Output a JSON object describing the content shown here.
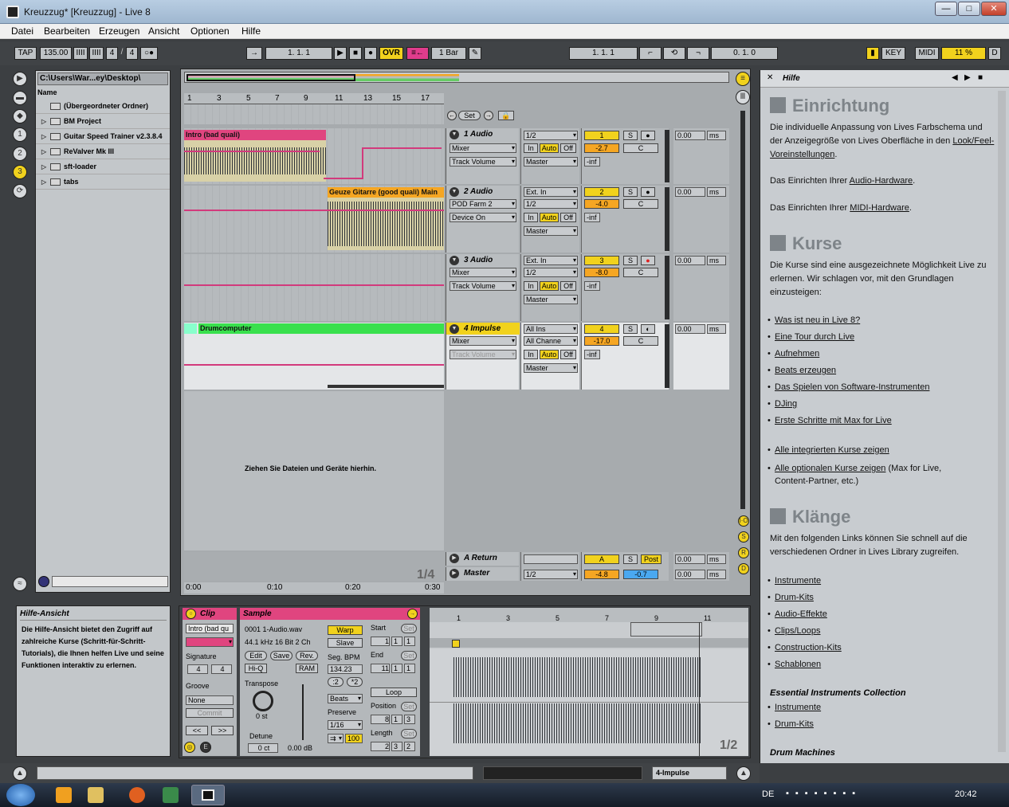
{
  "window": {
    "title": "Kreuzzug*  [Kreuzzug] - Live 8",
    "min": "—",
    "max": "□",
    "close": "✕"
  },
  "menu": [
    "Datei",
    "Bearbeiten",
    "Erzeugen",
    "Ansicht",
    "Optionen",
    "Hilfe"
  ],
  "toolbar": {
    "tap": "TAP",
    "tempo": "135.00",
    "sig_num": "4",
    "sig_den": "4",
    "sig_sep": "/",
    "pos": "1.   1.   1",
    "ovr": "OVR",
    "quant": "1 Bar",
    "loop_start": "1.   1.   1",
    "loop_len": "0.   1.   0",
    "key": "KEY",
    "midi": "MIDI",
    "cpu": "11 %",
    "d": "D"
  },
  "browser": {
    "path": "C:\\Users\\War...ey\\Desktop\\",
    "header": "Name",
    "items": [
      "(Übergeordneter Ordner)",
      "BM Project",
      "Guitar Speed Trainer v2.3.8.4",
      "ReValver Mk III",
      "sft-loader",
      "tabs"
    ]
  },
  "ruler": {
    "bars": [
      "1",
      "3",
      "5",
      "7",
      "9",
      "11",
      "13",
      "15",
      "17"
    ],
    "times": [
      "0:00",
      "0:10",
      "0:20",
      "0:30"
    ],
    "ratio": "1/4",
    "set": "Set"
  },
  "tracks": [
    {
      "name": "1 Audio",
      "clip": "Intro (bad quali)",
      "in": "1/2",
      "dev": "Mixer",
      "param": "Track Volume",
      "out": "Master",
      "num": "1",
      "vol": "-2.7",
      "pan": "C",
      "meter": "0.00",
      "ms": "ms",
      "inf": "-inf"
    },
    {
      "name": "2 Audio",
      "clip": "Geuze Gitarre (good quali) Main",
      "in": "Ext. In",
      "in2": "1/2",
      "dev": "POD Farm 2",
      "param": "Device On",
      "out": "Master",
      "num": "2",
      "vol": "-4.0",
      "pan": "C",
      "meter": "0.00",
      "ms": "ms",
      "inf": "-inf"
    },
    {
      "name": "3 Audio",
      "clip": "",
      "in": "Ext. In",
      "in2": "1/2",
      "dev": "Mixer",
      "param": "Track Volume",
      "out": "Master",
      "num": "3",
      "vol": "-8.0",
      "pan": "C",
      "meter": "0.00",
      "ms": "ms",
      "inf": "-inf"
    },
    {
      "name": "4 Impulse",
      "clip": "Drumcomputer",
      "in": "All Ins",
      "in2": "All Channe",
      "dev": "Mixer",
      "param": "Track Volume",
      "out": "Master",
      "num": "4",
      "vol": "-17.0",
      "pan": "C",
      "meter": "0.00",
      "ms": "ms",
      "inf": "-inf"
    }
  ],
  "monitor": {
    "in": "In",
    "auto": "Auto",
    "off": "Off",
    "solo": "S"
  },
  "drop_hint": "Ziehen Sie Dateien und Geräte hierhin.",
  "returns": {
    "a": "A Return",
    "a_letter": "A",
    "a_post": "Post",
    "master": "Master",
    "master_in": "1/2",
    "master_vol": "-4.8",
    "master_pan": "-0.7",
    "a_meter": "0.00",
    "m_meter": "0.00"
  },
  "help": {
    "title": "Hilfe",
    "h1": "Einrichtung",
    "p1a": "Die individuelle Anpassung von Lives Farbschema und der Anzeigegröße von Lives Oberfläche in den",
    "p1b": "Look/Feel-Voreinstellungen",
    "p2a": "Das Einrichten Ihrer",
    "p2b": "Audio-Hardware",
    "p3a": "Das Einrichten Ihrer",
    "p3b": "MIDI-Hardware",
    "h2": "Kurse",
    "p4": "Die Kurse sind eine ausgezeichnete Möglichkeit Live zu erlernen. Wir schlagen vor, mit den Grundlagen einzusteigen:",
    "links1": [
      "Was ist neu in Live 8?",
      "Eine Tour durch Live",
      "Aufnehmen",
      "Beats erzeugen",
      "Das Spielen von Software-Instrumenten",
      "DJing",
      "Erste Schritte mit Max for Live"
    ],
    "links2a": "Alle integrierten Kurse zeigen",
    "links2b": "Alle optionalen Kurse zeigen",
    "links2b_rest": "(Max for Live, Content-Partner, etc.)",
    "h3": "Klänge",
    "p5": "Mit den folgenden Links können Sie schnell auf die verschiedenen Ordner in Lives Library zugreifen.",
    "links3": [
      "Instrumente",
      "Drum-Kits",
      "Audio-Effekte",
      "Clips/Loops",
      "Construction-Kits",
      "Schablonen"
    ],
    "sub1": "Essential Instruments Collection",
    "links4": [
      "Instrumente",
      "Drum-Kits"
    ],
    "sub2": "Drum Machines"
  },
  "info": {
    "title": "Hilfe-Ansicht",
    "text": "Die Hilfe-Ansicht bietet den Zugriff auf zahlreiche Kurse (Schritt-für-Schritt-Tutorials), die Ihnen helfen Live und seine Funktionen interaktiv zu erlernen."
  },
  "clipview": {
    "clip": "Clip",
    "name": "Intro (bad qu",
    "signature": "Signature",
    "sig_n": "4",
    "sig_d": "4",
    "groove": "Groove",
    "groove_val": "None",
    "commit": "Commit",
    "sample": "Sample",
    "file": "0001 1-Audio.wav",
    "format": "44.1 kHz 16 Bit 2 Ch",
    "edit": "Edit",
    "save": "Save",
    "rev": "Rev.",
    "hiq": "Hi-Q",
    "ram": "RAM",
    "transpose": "Transpose",
    "st": "0 st",
    "detune": "Detune",
    "ct": "0 ct",
    "db": "0.00 dB",
    "warp": "Warp",
    "slave": "Slave",
    "segbpm": "Seg. BPM",
    "bpm": "134.23",
    "half": ":2",
    "dbl": "*2",
    "beats": "Beats",
    "preserve": "Preserve",
    "pres_val": "1/16",
    "pct": "100",
    "start": "Start",
    "end": "End",
    "loop": "Loop",
    "position": "Position",
    "length": "Length",
    "set": "Set",
    "s1": "1",
    "s2": "1",
    "s3": "1",
    "e1": "11",
    "e2": "1",
    "e3": "1",
    "p1": "8",
    "p2": "1",
    "p3": "3",
    "l1": "2",
    "l2": "3",
    "l3": "2",
    "ratio": "1/2",
    "bars": [
      "1",
      "3",
      "5",
      "7",
      "9",
      "11"
    ]
  },
  "status": {
    "track": "4-Impulse"
  },
  "taskbar": {
    "lang": "DE",
    "time": "20:42"
  }
}
